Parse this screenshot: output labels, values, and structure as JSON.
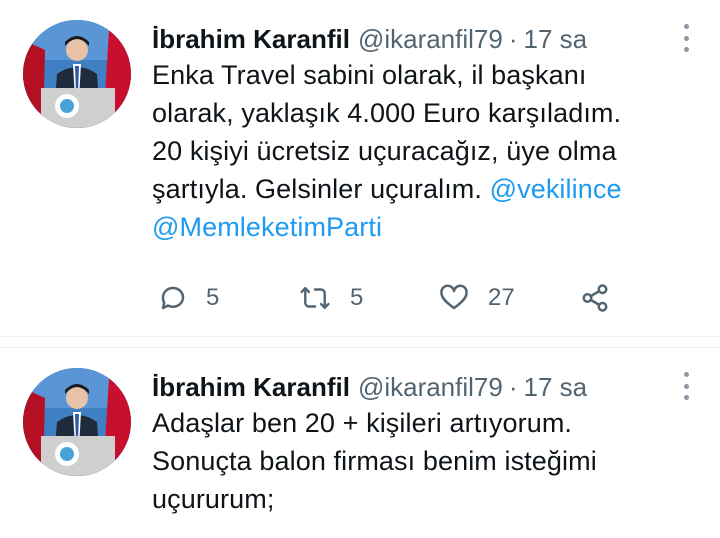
{
  "tweets": [
    {
      "author": {
        "name": "İbrahim Karanfil",
        "handle": "@ikaranfil79"
      },
      "separator": "·",
      "time": "17 sa",
      "lines": [
        "Enka Travel sabini olarak, il başkanı",
        "olarak, yaklaşık 4.000 Euro karşıladım.",
        "20 kişiyi ücretsiz uçuracağız, üye olma"
      ],
      "line4_text": "şartıyla. Gelsinler uçuralım. ",
      "mention1": "@vekilince",
      "mention2": "@MemleketimParti",
      "actions": {
        "replies": "5",
        "retweets": "5",
        "likes": "27"
      }
    },
    {
      "author": {
        "name": "İbrahim Karanfil",
        "handle": "@ikaranfil79"
      },
      "separator": "·",
      "time": "17 sa",
      "lines": [
        "Adaşlar ben 20 + kişileri artıyorum.",
        "Sonuçta balon firması benim isteğimi",
        "uçururum;"
      ]
    }
  ],
  "colors": {
    "text": "#0f1419",
    "secondary": "#536471",
    "link": "#1d9bf0",
    "divider": "#eff3f4"
  },
  "icons": [
    "more-vertical-icon",
    "reply-icon",
    "retweet-icon",
    "like-icon",
    "share-icon"
  ]
}
